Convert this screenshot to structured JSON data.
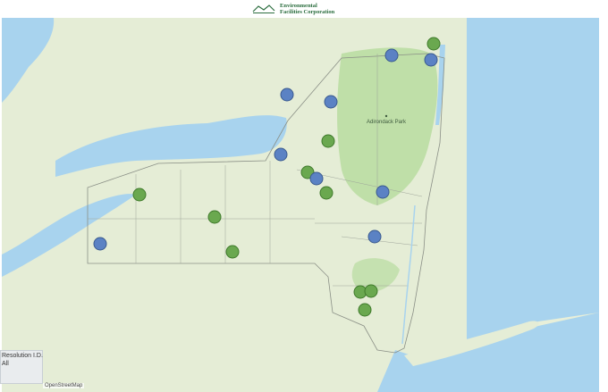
{
  "header": {
    "logo_line1": "Environmental",
    "logo_line2": "Facilities Corporation"
  },
  "map": {
    "park_label": "Adirondack Park",
    "attribution": "OpenStreetMap",
    "colors": {
      "water": "#a8d3ee",
      "land": "#e8efd9",
      "park": "#b8dca0",
      "marker_blue": "#5b82c4",
      "marker_green": "#6aa84f"
    }
  },
  "filter": {
    "label": "Resolution I.D.",
    "value": "All"
  },
  "markers": [
    {
      "type": "blue"
    },
    {
      "type": "green"
    },
    {
      "type": "blue"
    },
    {
      "type": "blue"
    },
    {
      "type": "blue"
    },
    {
      "type": "green"
    },
    {
      "type": "blue"
    },
    {
      "type": "green"
    },
    {
      "type": "blue"
    },
    {
      "type": "green"
    },
    {
      "type": "blue"
    },
    {
      "type": "green"
    },
    {
      "type": "green"
    },
    {
      "type": "blue"
    },
    {
      "type": "blue"
    },
    {
      "type": "green"
    },
    {
      "type": "green"
    },
    {
      "type": "green"
    },
    {
      "type": "green"
    }
  ]
}
